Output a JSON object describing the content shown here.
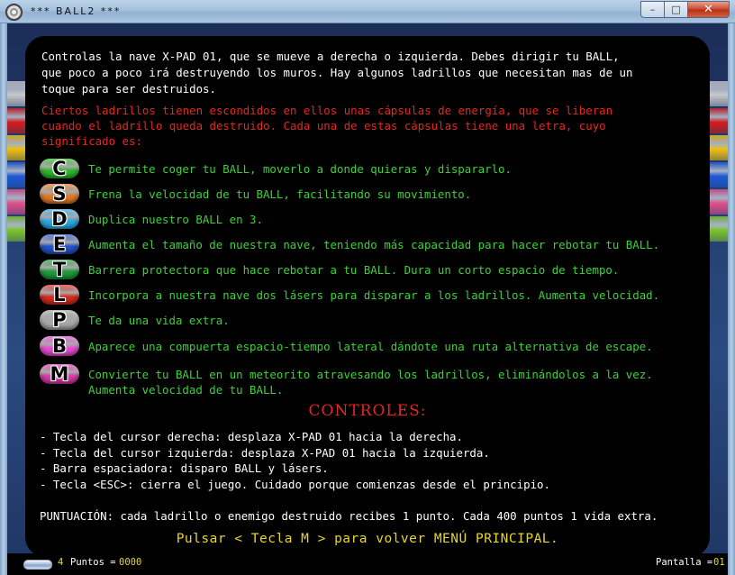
{
  "window": {
    "title": "*** BALL2 ***",
    "min_glyph": "–",
    "max_glyph": "□",
    "close_glyph": "✕"
  },
  "help": {
    "intro": "Controlas la nave X-PAD 01, que se mueve a derecha o izquierda. Debes dirigir tu BALL,\nque poco a poco irá destruyendo los muros. Hay algunos ladrillos que necesitan mas de un\ntoque para ser destruidos.",
    "capsules_intro": "Ciertos ladrillos tienen escondidos en ellos unas cápsulas de energía, que se liberan\ncuando el ladrillo queda destruido. Cada una de estas cápsulas tiene una letra, cuyo\nsignificado es:",
    "capsules": [
      {
        "letter": "C",
        "color": "#2fb52a",
        "description": "Te permite coger tu BALL, moverlo a donde quieras y dispararlo."
      },
      {
        "letter": "S",
        "color": "#e07a28",
        "description": "Frena la velocidad de tu BALL, facilitando su movimiento."
      },
      {
        "letter": "D",
        "color": "#29a8e0",
        "description": "Duplica nuestro BALL en 3."
      },
      {
        "letter": "E",
        "color": "#2452c8",
        "description": "Aumenta el tamaño de nuestra nave, teniendo más capacidad para hacer rebotar tu BALL."
      },
      {
        "letter": "T",
        "color": "#1f9a3a",
        "description": "Barrera protectora que hace rebotar a tu BALL. Dura un corto espacio de tiempo."
      },
      {
        "letter": "L",
        "color": "#d42a1e",
        "description": "Incorpora a nuestra nave dos lásers para disparar a los ladrillos. Aumenta velocidad."
      },
      {
        "letter": "P",
        "color": "#a8a8a8",
        "description": "Te da una vida extra."
      },
      {
        "letter": "B",
        "color": "#e64ad0",
        "description": "Aparece una compuerta espacio-tiempo lateral dándote una ruta alternativa de escape."
      },
      {
        "letter": "M",
        "color": "#d83aa8",
        "description": "Convierte tu BALL en un meteorito atravesando los ladrillos, eliminándolos a la vez.\nAumenta velocidad de tu BALL."
      }
    ],
    "controls_heading": "CONTROLES:",
    "controls": [
      "- Tecla del cursor derecha: desplaza X-PAD 01 hacia la derecha.",
      "- Tecla del cursor izquierda: desplaza X-PAD 01 hacia la izquierda.",
      "- Barra espaciadora: disparo BALL y lásers.",
      "- Tecla <ESC>: cierra el juego. Cuidado porque comienzas desde el principio."
    ],
    "scoring": "PUNTUACIÓN: cada ladrillo o enemigo destruido recibes 1 punto. Cada 400 puntos 1 vida extra.",
    "back_hint": "Pulsar < Tecla M > para volver MENÚ PRINCIPAL."
  },
  "bricks": {
    "row_colors": [
      "#c8c8c8",
      "#d41c1c",
      "#f0c010",
      "#1e5ad8",
      "#e0508a",
      "#7cc42a"
    ]
  },
  "status": {
    "lives": "4",
    "score_label": "Puntos =",
    "score": "0000",
    "screen_label": "Pantalla =",
    "screen": "01"
  },
  "colors": {
    "text_white": "#ffffff",
    "text_red": "#e6271f",
    "text_green": "#3ed13a",
    "text_yellow": "#e8d62a"
  }
}
